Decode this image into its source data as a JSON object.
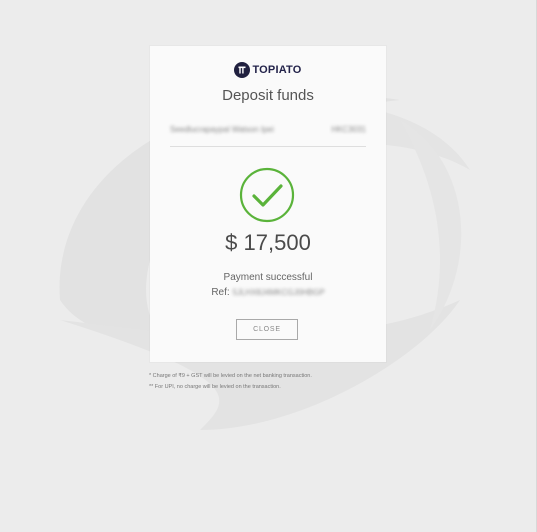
{
  "brand": {
    "logo_text": "TOPIATO",
    "logo_mark": "T"
  },
  "dialog": {
    "title": "Deposit funds",
    "merchant_name": "Seedlucrapaypal Watson Ipei",
    "merchant_code": "HKC3031",
    "amount": "$ 17,500",
    "status_text": "Payment successful",
    "ref_label": "Ref:",
    "ref_value": "5JLHX8J4MKCGJ0HBGP",
    "close_label": "CLOSE",
    "success_color": "#5ab33a"
  },
  "footnotes": [
    "* Charge of ₹9 + GST will be levied on the net banking transaction.",
    "** For UPI, no charge will be levied on the transaction."
  ],
  "icons": {
    "success": "check-circle-icon",
    "logo": "brand-logo-icon"
  }
}
